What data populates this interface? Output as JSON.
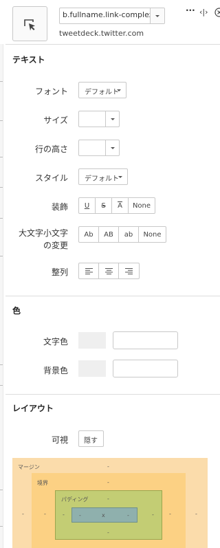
{
  "header": {
    "selector": "b.fullname.link-complex-target",
    "domain": "tweetdeck.twitter.com",
    "icons": [
      "ellipsis-icon",
      "resize-horizontal-icon",
      "close-circle-icon"
    ]
  },
  "text_section": {
    "title": "テキスト",
    "font": {
      "label": "フォント",
      "value": "デフォルト"
    },
    "size": {
      "label": "サイズ",
      "value": ""
    },
    "line_height": {
      "label": "行の高さ",
      "value": ""
    },
    "style": {
      "label": "スタイル",
      "value": "デフォルト"
    },
    "decoration": {
      "label": "装飾",
      "options": [
        "U",
        "S",
        "A",
        "None"
      ]
    },
    "case": {
      "label_line1": "大文字小文字",
      "label_line2": "の変更",
      "options": [
        "Ab",
        "AB",
        "ab",
        "None"
      ]
    },
    "align": {
      "label": "整列",
      "options": [
        "align-left-icon",
        "align-center-icon",
        "align-right-icon"
      ]
    }
  },
  "color_section": {
    "title": "色",
    "text_color": {
      "label": "文字色",
      "value": ""
    },
    "bg_color": {
      "label": "背景色",
      "value": ""
    }
  },
  "layout_section": {
    "title": "レイアウト",
    "visibility": {
      "label": "可視",
      "button": "隠す"
    },
    "box_model": {
      "margin_label": "マージン",
      "border_label": "境界",
      "padding_label": "パディング",
      "content": "x",
      "dash": "-",
      "colors": {
        "margin": "#fbdcab",
        "border": "#fcd184",
        "padding": "#c3cd74",
        "content": "#8fb0ad"
      }
    }
  }
}
